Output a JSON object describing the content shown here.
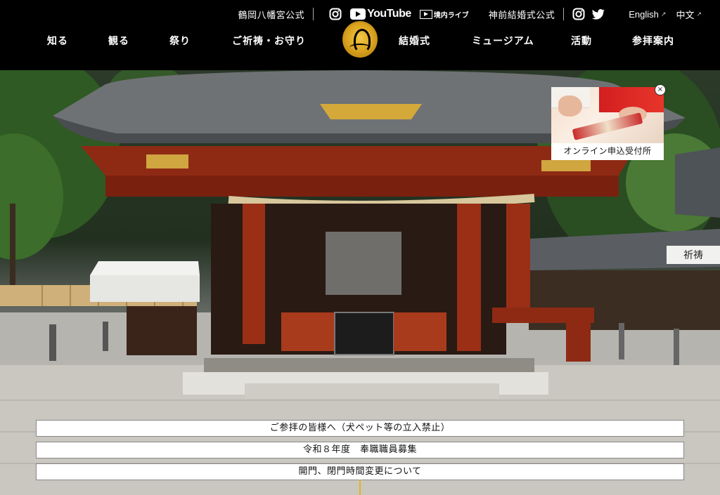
{
  "topbar": {
    "group1_label": "鶴岡八幡宮公式",
    "youtube_label": "YouTube",
    "live_label": "境内ライブ",
    "group2_label": "神前結婚式公式",
    "english_label": "English",
    "chinese_label": "中文",
    "icons": [
      "instagram-icon",
      "youtube-icon",
      "live-icon",
      "instagram-icon",
      "twitter-icon",
      "external-arrow-icon"
    ]
  },
  "nav": {
    "items": [
      "知る",
      "観る",
      "祭り",
      "ご祈祷・お守り",
      "結婚式",
      "ミュージアム",
      "活動",
      "参拝案内"
    ]
  },
  "popup": {
    "caption": "オンライン申込受付所",
    "close_symbol": "×"
  },
  "scene": {
    "sign_text": "祈祷"
  },
  "notices": [
    "ご参拝の皆様へ（犬ペット等の立入禁止）",
    "令和８年度　奉職職員募集",
    "開門、閉門時間変更について"
  ],
  "colors": {
    "header_bg": "#000000",
    "accent_gold": "#e8b21e",
    "shrine_red": "#8e2a14"
  }
}
